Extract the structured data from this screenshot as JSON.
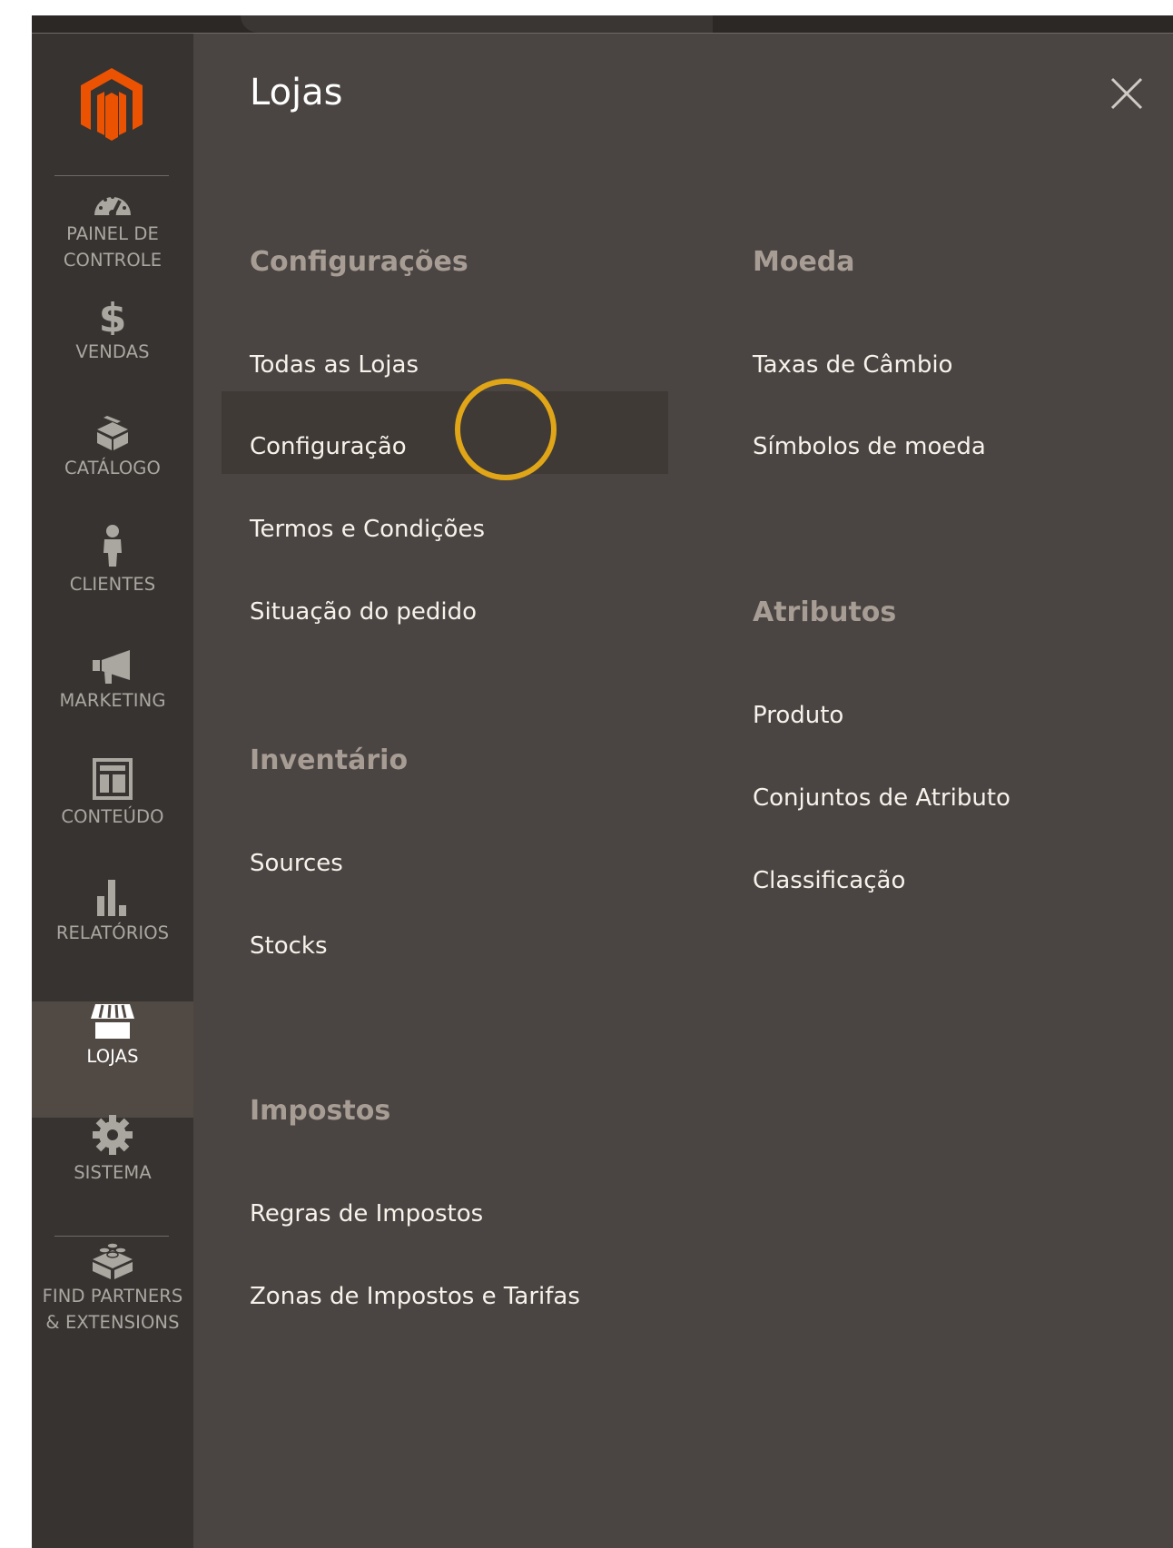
{
  "sidebar": {
    "logo_icon": "magento-logo-icon",
    "items": [
      {
        "label": "PAINEL DE\nCONTROLE",
        "icon": "dashboard-icon"
      },
      {
        "label": "VENDAS",
        "icon": "dollar-icon"
      },
      {
        "label": "CATÁLOGO",
        "icon": "box-icon"
      },
      {
        "label": "CLIENTES",
        "icon": "person-icon"
      },
      {
        "label": "MARKETING",
        "icon": "megaphone-icon"
      },
      {
        "label": "CONTEÚDO",
        "icon": "layout-icon"
      },
      {
        "label": "RELATÓRIOS",
        "icon": "bar-chart-icon"
      },
      {
        "label": "LOJAS",
        "icon": "store-icon",
        "active": true
      },
      {
        "label": "SISTEMA",
        "icon": "gear-icon"
      },
      {
        "label": "FIND PARTNERS\n& EXTENSIONS",
        "icon": "lego-block-icon"
      }
    ]
  },
  "panel": {
    "title": "Lojas",
    "close_icon": "close-icon",
    "sections": {
      "configuracoes": {
        "title": "Configurações",
        "links": [
          "Todas as Lojas",
          "Configuração",
          "Termos e Condições",
          "Situação do pedido"
        ]
      },
      "inventario": {
        "title": "Inventário",
        "links": [
          "Sources",
          "Stocks"
        ]
      },
      "impostos": {
        "title": "Impostos",
        "links": [
          "Regras de Impostos",
          "Zonas de Impostos e Tarifas"
        ]
      },
      "moeda": {
        "title": "Moeda",
        "links": [
          "Taxas de Câmbio",
          "Símbolos de moeda"
        ]
      },
      "atributos": {
        "title": "Atributos",
        "links": [
          "Produto",
          "Conjuntos de Atributo",
          "Classificação"
        ]
      }
    },
    "hovered_link": "Configuração"
  },
  "colors": {
    "brand": "#eb5202",
    "cursor_ring": "#e0a617",
    "panel_bg": "#4a4542",
    "sidebar_bg": "#373330",
    "active_item_bg": "#514943"
  }
}
